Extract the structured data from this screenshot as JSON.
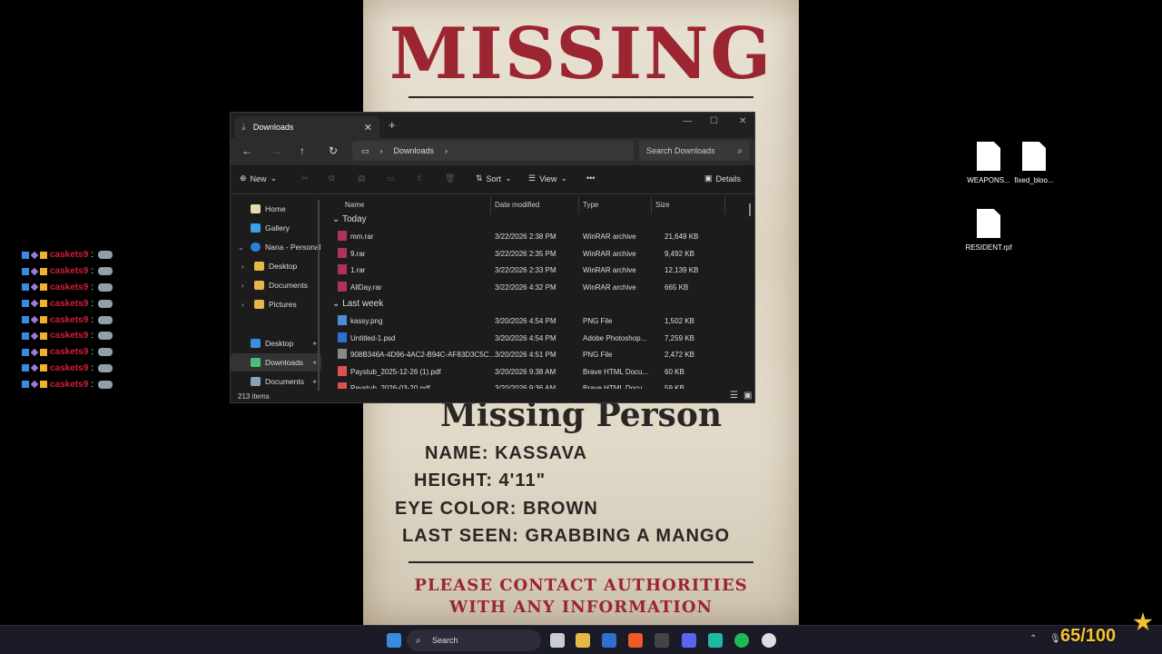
{
  "poster": {
    "title": "MISSING",
    "subtitle": "Missing Person",
    "name": "NAME: KASSAVA",
    "height": "HEIGHT: 4'11\"",
    "eye_color": "EYE COLOR: BROWN",
    "last_seen": "LAST SEEN: GRABBING A MANGO",
    "contact_line1": "PLEASE CONTACT AUTHORITIES",
    "contact_line2": "WITH ANY INFORMATION"
  },
  "chat": {
    "username": "caskets9",
    "colon": ":",
    "rows": 9
  },
  "desktop": {
    "icons": [
      "WEAPONS...",
      "fixed_bloo...",
      "RESIDENT.rpf"
    ]
  },
  "explorer": {
    "tab_title": "Downloads",
    "new_tab": "+",
    "address_root": "Downloads",
    "search_placeholder": "Search Downloads",
    "toolbar": {
      "new": "New",
      "sort": "Sort",
      "view": "View",
      "more": "•••",
      "details": "Details"
    },
    "sidebar": [
      {
        "label": "Home"
      },
      {
        "label": "Gallery"
      },
      {
        "label": "Nana - Personal"
      },
      {
        "label": "Desktop"
      },
      {
        "label": "Documents"
      },
      {
        "label": "Pictures"
      },
      {
        "label": "Desktop"
      },
      {
        "label": "Downloads"
      },
      {
        "label": "Documents"
      }
    ],
    "columns": [
      "Name",
      "Date modified",
      "Type",
      "Size"
    ],
    "groups": [
      "Today",
      "Last week"
    ],
    "today": [
      {
        "name": "mm.rar",
        "date": "3/22/2026 2:38 PM",
        "type": "WinRAR archive",
        "size": "21,649 KB"
      },
      {
        "name": "9.rar",
        "date": "3/22/2026 2:35 PM",
        "type": "WinRAR archive",
        "size": "9,492 KB"
      },
      {
        "name": "1.rar",
        "date": "3/22/2026 2:33 PM",
        "type": "WinRAR archive",
        "size": "12,139 KB"
      },
      {
        "name": "AllDay.rar",
        "date": "3/22/2026 4:32 PM",
        "type": "WinRAR archive",
        "size": "665 KB"
      }
    ],
    "last_week": [
      {
        "name": "kassy.png",
        "date": "3/20/2026 4:54 PM",
        "type": "PNG File",
        "size": "1,502 KB"
      },
      {
        "name": "Untitled-1.psd",
        "date": "3/20/2026 4:54 PM",
        "type": "Adobe Photoshop...",
        "size": "7,259 KB"
      },
      {
        "name": "908B346A-4D96-4AC2-B94C-AF83D3C5C...",
        "date": "3/20/2026 4:51 PM",
        "type": "PNG File",
        "size": "2,472 KB"
      },
      {
        "name": "Paystub_2025-12-26 (1).pdf",
        "date": "3/20/2026 9:38 AM",
        "type": "Brave HTML Docu...",
        "size": "60 KB"
      },
      {
        "name": "Paystub_2026-03-20.pdf",
        "date": "3/20/2026 9:36 AM",
        "type": "Brave HTML Docu...",
        "size": "59 KB"
      }
    ],
    "status": "213 items"
  },
  "taskbar": {
    "search_label": "Search",
    "counter": "65/100"
  }
}
